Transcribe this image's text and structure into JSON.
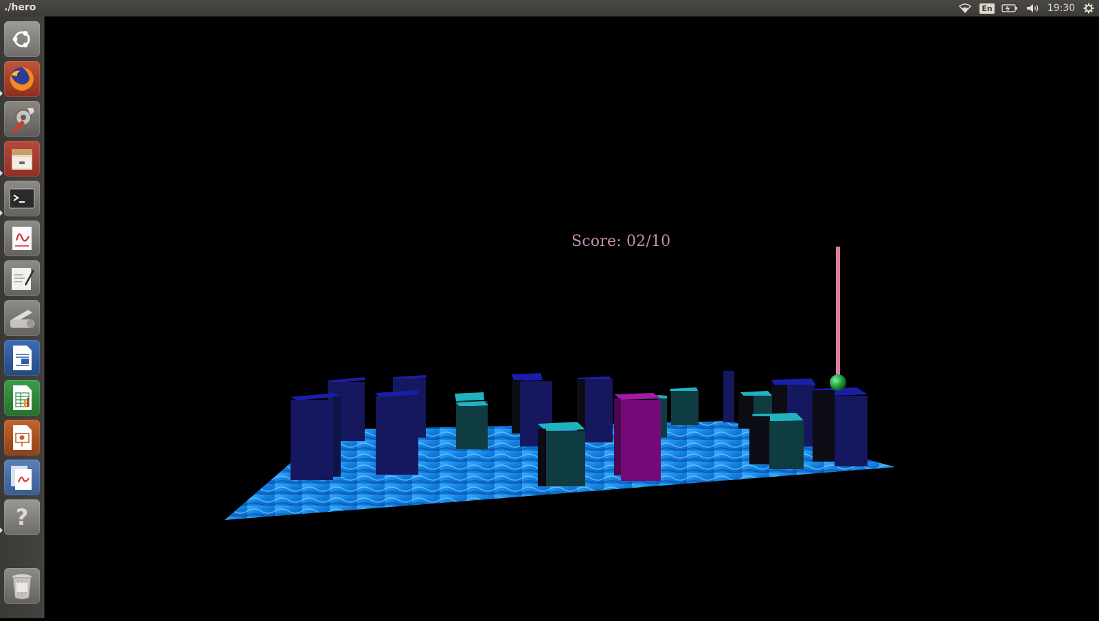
{
  "window": {
    "title": "./hero"
  },
  "topbar": {
    "keyboard_layout": "En",
    "clock": "19:30",
    "icons": [
      "wifi-icon",
      "battery-icon",
      "volume-icon",
      "settings-gear-icon"
    ]
  },
  "launcher": {
    "items": [
      {
        "name": "ubuntu-dash",
        "icon": "ubuntu-logo-icon"
      },
      {
        "name": "firefox",
        "icon": "firefox-icon"
      },
      {
        "name": "system-settings",
        "icon": "wrench-gear-icon"
      },
      {
        "name": "files",
        "icon": "file-cabinet-icon"
      },
      {
        "name": "terminal",
        "icon": "terminal-icon"
      },
      {
        "name": "document-viewer",
        "icon": "pdf-viewer-icon"
      },
      {
        "name": "text-editor",
        "icon": "text-editor-icon"
      },
      {
        "name": "scanner",
        "icon": "scanner-icon"
      },
      {
        "name": "libreoffice-writer",
        "icon": "writer-icon"
      },
      {
        "name": "libreoffice-calc",
        "icon": "calc-icon"
      },
      {
        "name": "libreoffice-impress",
        "icon": "impress-icon"
      },
      {
        "name": "pdf-documents",
        "icon": "pdf-stack-icon"
      },
      {
        "name": "help",
        "icon": "help-icon",
        "glyph": "?"
      },
      {
        "name": "trash",
        "icon": "trash-icon"
      }
    ]
  },
  "game": {
    "score_label": "Score: 02/10",
    "colors": {
      "background": "#000000",
      "water": "#1a8fe8",
      "tower_blue": "#151a5c",
      "tower_teal": "#0f3c40",
      "tower_magenta": "#730a78",
      "player_pole": "#d77ea5",
      "player_ball": "#1a9a3c"
    }
  }
}
